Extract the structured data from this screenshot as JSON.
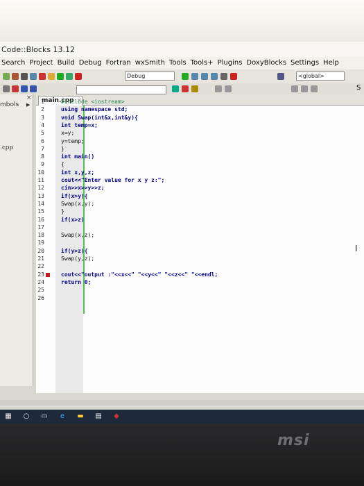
{
  "window": {
    "title": "Code::Blocks 13.12"
  },
  "menu": [
    "Search",
    "Project",
    "Build",
    "Debug",
    "Fortran",
    "wxSmith",
    "Tools",
    "Tools+",
    "Plugins",
    "DoxyBlocks",
    "Settings",
    "Help"
  ],
  "toolbar": {
    "build_target": "Debug",
    "scope": "<global>",
    "search_partial": "S"
  },
  "side_panel": {
    "symbols_tab": "mbols",
    "file": ".cpp"
  },
  "editor": {
    "tab_label": "main.cpp",
    "tab_close": "×",
    "lines": [
      {
        "n": "1",
        "text": "#include <iostream>"
      },
      {
        "n": "2",
        "text": "using namespace std;"
      },
      {
        "n": "3",
        "text": "void Swap(int&x,int&y){"
      },
      {
        "n": "4",
        "text": "int temp=x;"
      },
      {
        "n": "5",
        "text": "x=y;"
      },
      {
        "n": "6",
        "text": "y=temp;"
      },
      {
        "n": "7",
        "text": "}"
      },
      {
        "n": "8",
        "text": "int main()"
      },
      {
        "n": "9",
        "text": "{"
      },
      {
        "n": "10",
        "text": "int x,y,z;"
      },
      {
        "n": "11",
        "text": "cout<<\"Enter value for x y z:\";"
      },
      {
        "n": "12",
        "text": "cin>>x>>y>>z;"
      },
      {
        "n": "13",
        "text": "if(x>y){"
      },
      {
        "n": "14",
        "text": "Swap(x,y);"
      },
      {
        "n": "15",
        "text": "}"
      },
      {
        "n": "16",
        "text": "if(x>z)"
      },
      {
        "n": "17",
        "text": ""
      },
      {
        "n": "18",
        "text": "Swap(x,z);"
      },
      {
        "n": "19",
        "text": ""
      },
      {
        "n": "20",
        "text": "if(y>z){"
      },
      {
        "n": "21",
        "text": "Swap(y,z);"
      },
      {
        "n": "22",
        "text": ""
      },
      {
        "n": "23",
        "text": "cout<<\"output :\"<<x<<\" \"<<y<<\" \"<<z<<\" \"<<endl;"
      },
      {
        "n": "24",
        "text": "return 0;"
      },
      {
        "n": "25",
        "text": ""
      },
      {
        "n": "26",
        "text": ""
      }
    ]
  },
  "brand": {
    "logo": "msi"
  }
}
